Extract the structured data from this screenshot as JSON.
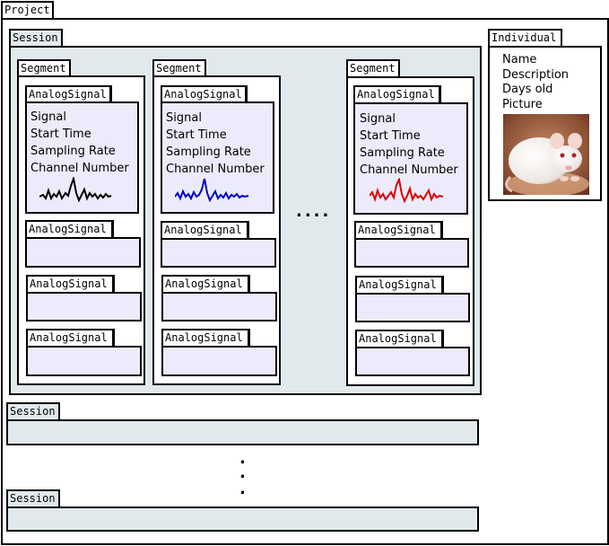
{
  "project": {
    "label": "Project"
  },
  "session_label": "Session",
  "segment_label": "Segment",
  "analog_signal_label": "AnalogSignal",
  "signal_fields": [
    "Signal",
    "Start Time",
    "Sampling Rate",
    "Channel Number"
  ],
  "segments": [
    {
      "trace_color": "#000000"
    },
    {
      "trace_color": "#0000cc"
    },
    {
      "trace_color": "#dd0000"
    }
  ],
  "more_segments": "....",
  "more_sessions": [
    ".",
    ".",
    "."
  ],
  "individual": {
    "label": "Individual",
    "fields": [
      "Name",
      "Description",
      "Days old",
      "Picture"
    ],
    "picture_icon": "white-mouse-photo"
  }
}
